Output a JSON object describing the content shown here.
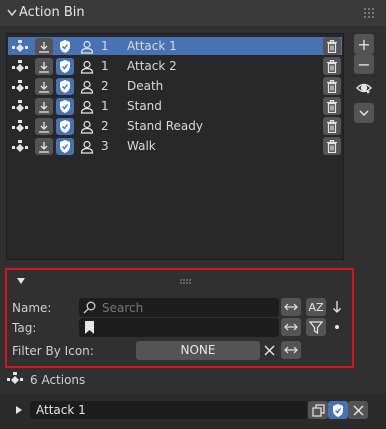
{
  "panel": {
    "title": "Action Bin"
  },
  "actions": [
    {
      "count": "1",
      "name": "Attack 1",
      "selected": true
    },
    {
      "count": "1",
      "name": "Attack 2",
      "selected": false
    },
    {
      "count": "2",
      "name": "Death",
      "selected": false
    },
    {
      "count": "1",
      "name": "Stand",
      "selected": false
    },
    {
      "count": "2",
      "name": "Stand Ready",
      "selected": false
    },
    {
      "count": "3",
      "name": "Walk",
      "selected": false
    }
  ],
  "side_buttons": {
    "add": "+",
    "remove": "−"
  },
  "filter": {
    "name_label": "Name:",
    "search_placeholder": "Search",
    "tag_label": "Tag:",
    "filter_icon_label": "Filter By Icon:",
    "filter_icon_value": "NONE",
    "sort_az": "AZ"
  },
  "footer": {
    "actions_count_text": "6 Actions",
    "active_action_name": "Attack 1"
  },
  "colors": {
    "selection": "#4772b3",
    "highlight_border": "#d4141c"
  }
}
